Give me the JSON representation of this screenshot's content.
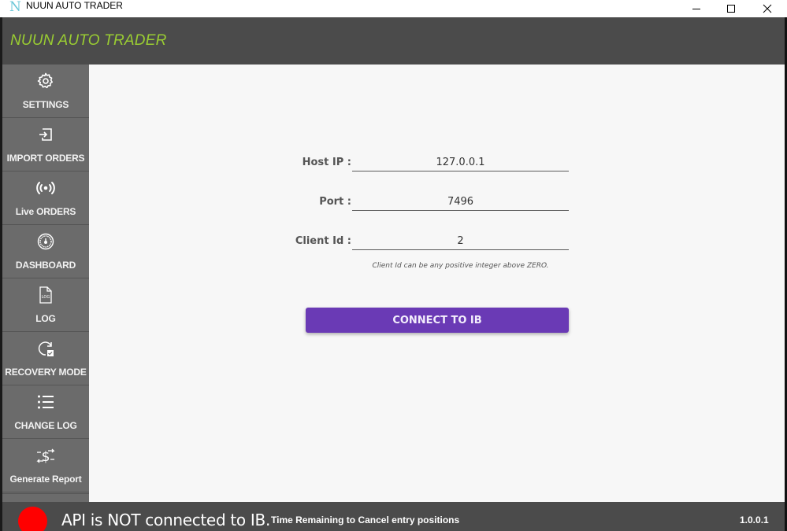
{
  "window": {
    "title": "NUUN AUTO TRADER",
    "app_icon_glyph": "N",
    "controls": [
      "minimize",
      "maximize",
      "close"
    ]
  },
  "header": {
    "title": "NUUN AUTO TRADER",
    "title_color": "#9acd32"
  },
  "sidebar": {
    "items": [
      {
        "label": "SETTINGS",
        "icon": "gear-icon"
      },
      {
        "label": "IMPORT ORDERS",
        "icon": "import-icon"
      },
      {
        "label": "Live ORDERS",
        "icon": "broadcast-icon"
      },
      {
        "label": "DASHBOARD",
        "icon": "dashboard-icon"
      },
      {
        "label": "LOG",
        "icon": "log-file-icon"
      },
      {
        "label": "RECOVERY MODE",
        "icon": "recovery-icon"
      },
      {
        "label": "CHANGE LOG",
        "icon": "list-icon"
      },
      {
        "label": "Generate Report",
        "icon": "dollar-exchange-icon"
      }
    ]
  },
  "form": {
    "host_ip": {
      "label": "Host IP :",
      "value": "127.0.0.1"
    },
    "port": {
      "label": "Port :",
      "value": "7496"
    },
    "client_id": {
      "label": "Client Id :",
      "value": "2"
    },
    "hint": "Client Id can be any positive integer above ZERO.",
    "connect_button": "CONNECT TO IB",
    "accent_color": "#6a3ab5"
  },
  "status": {
    "indicator_color": "#ff0000",
    "message": "API is NOT connected to IB.",
    "time_remaining_label": "Time Remaining to Cancel entry positions",
    "version": "1.0.0.1"
  }
}
